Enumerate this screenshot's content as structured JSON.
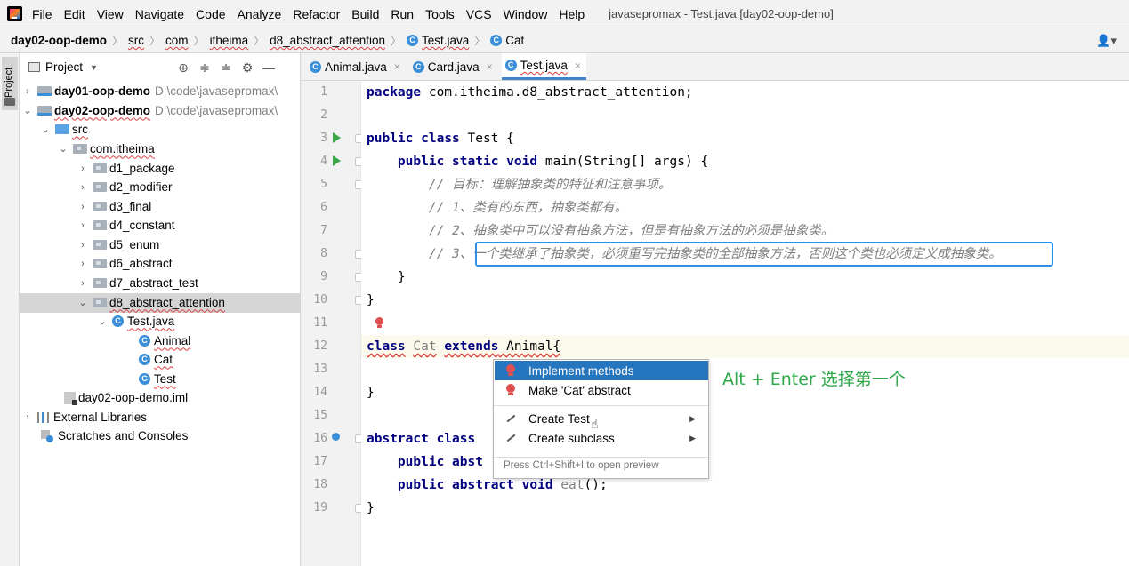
{
  "window_title": "javasepromax - Test.java [day02-oop-demo]",
  "menu": [
    "File",
    "Edit",
    "View",
    "Navigate",
    "Code",
    "Analyze",
    "Refactor",
    "Build",
    "Run",
    "Tools",
    "VCS",
    "Window",
    "Help"
  ],
  "breadcrumb": [
    "day02-oop-demo",
    "src",
    "com",
    "itheima",
    "d8_abstract_attention",
    "Test.java",
    "Cat"
  ],
  "project_panel": {
    "title": "Project",
    "tree": [
      {
        "label": "day01-oop-demo",
        "path": "D:\\code\\javasepromax\\"
      },
      {
        "label": "day02-oop-demo",
        "path": "D:\\code\\javasepromax\\"
      },
      {
        "label": "src"
      },
      {
        "label": "com.itheima"
      },
      {
        "label": "d1_package"
      },
      {
        "label": "d2_modifier"
      },
      {
        "label": "d3_final"
      },
      {
        "label": "d4_constant"
      },
      {
        "label": "d5_enum"
      },
      {
        "label": "d6_abstract"
      },
      {
        "label": "d7_abstract_test"
      },
      {
        "label": "d8_abstract_attention"
      },
      {
        "label": "Test.java"
      },
      {
        "label": "Animal"
      },
      {
        "label": "Cat"
      },
      {
        "label": "Test"
      },
      {
        "label": "day02-oop-demo.iml"
      },
      {
        "label": "External Libraries"
      },
      {
        "label": "Scratches and Consoles"
      }
    ]
  },
  "tabs": [
    {
      "label": "Animal.java"
    },
    {
      "label": "Card.java"
    },
    {
      "label": "Test.java"
    }
  ],
  "line_numbers": [
    "1",
    "2",
    "3",
    "4",
    "5",
    "6",
    "7",
    "8",
    "9",
    "10",
    "11",
    "12",
    "13",
    "14",
    "15",
    "16",
    "17",
    "18",
    "19"
  ],
  "code": {
    "l1": {
      "kw": "package",
      "rest": " com.itheima.d8_abstract_attention;"
    },
    "l3": {
      "kw1": "public",
      "kw2": "class",
      "rest": " Test {"
    },
    "l4": {
      "kw1": "public",
      "kw2": "static",
      "kw3": "void",
      "rest": " main(String[] args) {"
    },
    "l5": "// 目标：理解抽象类的特征和注意事项。",
    "l6": "// 1、类有的东西，抽象类都有。",
    "l7": "// 2、抽象类中可以没有抽象方法，但是有抽象方法的必须是抽象类。",
    "l8a": "// 3、",
    "l8b": "一个类继承了抽象类，必须重写完抽象类的全部抽象方法，否则这个类也必须定义成抽象类。",
    "l9": "}",
    "l10": "}",
    "l12": {
      "kw1": "class",
      "name": "Cat",
      "kw2": "extends",
      "rest": " Animal{"
    },
    "l14": "}",
    "l16": {
      "kw1": "abstract",
      "kw2": "class",
      "rest": ""
    },
    "l17": {
      "kw1": "public",
      "kw2": "abst",
      "rest": ""
    },
    "l18": {
      "kw1": "public",
      "kw2": "abstract",
      "kw3": "void",
      "name": "eat",
      "rest": "();"
    },
    "l19": "}"
  },
  "popup": {
    "items": [
      "Implement methods",
      "Make 'Cat' abstract",
      "Create Test",
      "Create subclass"
    ],
    "hint": "Press Ctrl+Shift+I to open preview"
  },
  "annotation": "Alt + Enter 选择第一个"
}
